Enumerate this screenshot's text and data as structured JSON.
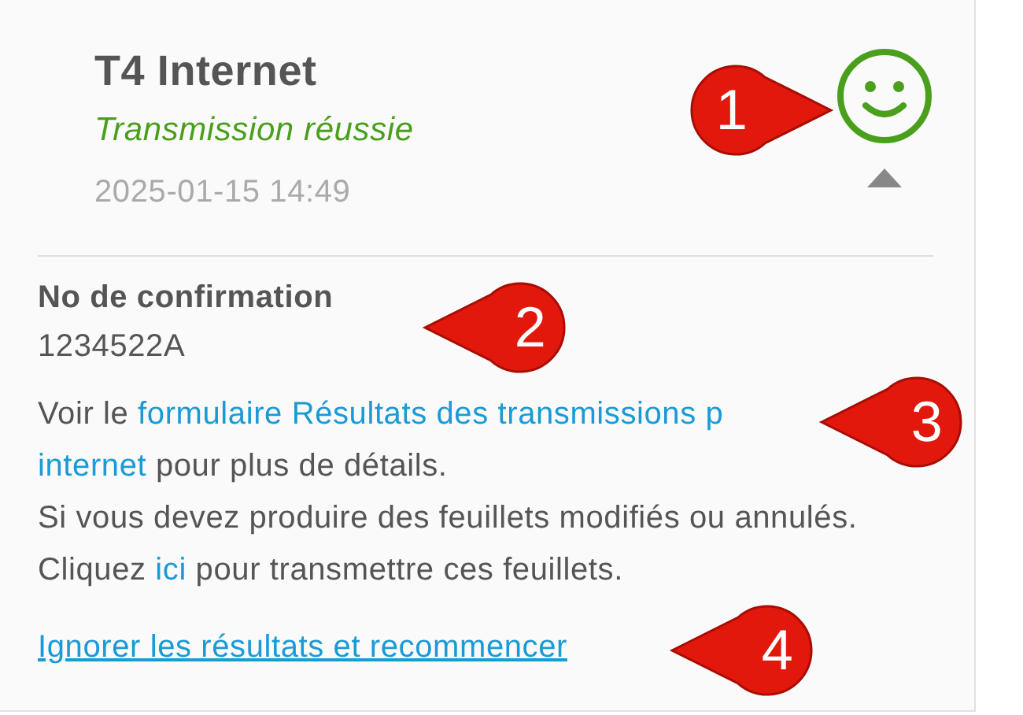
{
  "header": {
    "title": "T4 Internet",
    "status": "Transmission réussie",
    "timestamp": "2025-01-15 14:49",
    "expanded": true
  },
  "confirmation": {
    "label": "No de confirmation",
    "number": "1234522A"
  },
  "paragraphs": [
    {
      "parts": [
        {
          "kind": "text",
          "text": "Voir le "
        },
        {
          "kind": "link",
          "text": "formulaire Résultats des transmissions p"
        },
        {
          "kind": "break"
        },
        {
          "kind": "link",
          "text": "internet"
        },
        {
          "kind": "text",
          "text": " pour plus de détails."
        }
      ]
    },
    {
      "parts": [
        {
          "kind": "text",
          "text": "Si vous devez produire des feuillets modifiés ou annulés. Cliquez "
        },
        {
          "kind": "link",
          "text": "ici"
        },
        {
          "kind": "text",
          "text": " pour transmettre ces feuillets."
        }
      ]
    }
  ],
  "restart_link": "Ignorer les résultats et recommencer",
  "callouts": [
    {
      "number": "1"
    },
    {
      "number": "2"
    },
    {
      "number": "3"
    },
    {
      "number": "4"
    }
  ]
}
